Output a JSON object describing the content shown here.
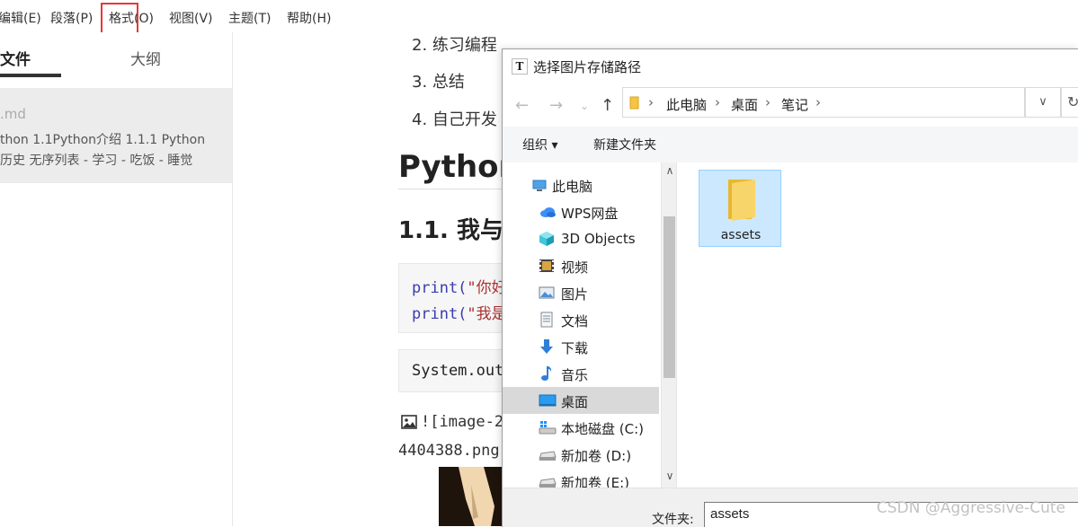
{
  "menubar": {
    "items": [
      "编辑(E)",
      "段落(P)",
      "格式(O)",
      "视图(V)",
      "主题(T)",
      "帮助(H)"
    ]
  },
  "sidebar": {
    "tabs": {
      "files": "文件",
      "outline": "大纲"
    },
    "file": {
      "name": ".md",
      "excerpt_line1": "thon 1.1Python介绍 1.1.1 Python",
      "excerpt_line2": "历史 无序列表 - 学习 - 吃饭 - 睡觉"
    }
  },
  "editor": {
    "list_items": [
      "2. 练习编程",
      "3. 总结",
      "4. 自己开发"
    ],
    "heading1": "Python",
    "heading2": "1.1. 我与",
    "code_block1": {
      "line1_fn": "print(",
      "line1_str": "\"你好",
      "line2_fn": "print(",
      "line2_str": "\"我是"
    },
    "code_block2": "System.out",
    "image_ref_line1": "![image-2",
    "image_ref_line2": "4404388.png"
  },
  "dialog": {
    "title": "选择图片存储路径",
    "breadcrumb": [
      "此电脑",
      "桌面",
      "笔记"
    ],
    "toolbar": {
      "organize": "组织 ▾",
      "new_folder": "新建文件夹"
    },
    "nav_items": [
      {
        "label": "此电脑",
        "icon": "computer-icon"
      },
      {
        "label": "WPS网盘",
        "icon": "cloud-icon"
      },
      {
        "label": "3D Objects",
        "icon": "cube-icon"
      },
      {
        "label": "视频",
        "icon": "video-icon"
      },
      {
        "label": "图片",
        "icon": "picture-icon"
      },
      {
        "label": "文档",
        "icon": "document-icon"
      },
      {
        "label": "下载",
        "icon": "download-icon"
      },
      {
        "label": "音乐",
        "icon": "music-icon"
      },
      {
        "label": "桌面",
        "icon": "desktop-icon",
        "selected": true
      },
      {
        "label": "本地磁盘 (C:)",
        "icon": "drive-c-icon"
      },
      {
        "label": "新加卷 (D:)",
        "icon": "drive-icon"
      },
      {
        "label": "新加卷 (E:)",
        "icon": "drive-icon"
      }
    ],
    "files": [
      {
        "name": "assets",
        "type": "folder",
        "selected": true
      }
    ],
    "folder_field": {
      "label": "文件夹:",
      "value": "assets"
    }
  },
  "watermark": "CSDN @Aggressive-Cute",
  "colors": {
    "highlight_box": "#e53935",
    "selection": "#cce8ff",
    "folder": "#f5c542"
  }
}
